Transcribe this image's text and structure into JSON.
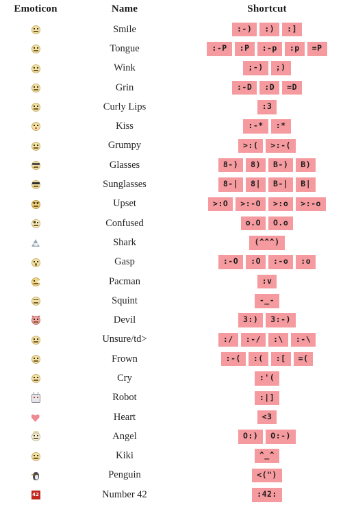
{
  "table": {
    "headers": {
      "emoticon": "Emoticon",
      "name": "Name",
      "shortcut": "Shortcut"
    },
    "badge_color": "#f59a9e",
    "badge_text_color": "#1c1c1c",
    "rows": [
      {
        "icon": "smile-face-icon",
        "variant": "smile",
        "name": "Smile",
        "shortcuts": [
          ":-)",
          ":)",
          ":]"
        ]
      },
      {
        "icon": "tongue-face-icon",
        "variant": "tongue",
        "name": "Tongue",
        "shortcuts": [
          ":-P",
          ":P",
          ":-p",
          ":p",
          "=P"
        ]
      },
      {
        "icon": "wink-face-icon",
        "variant": "wink",
        "name": "Wink",
        "shortcuts": [
          ";-)",
          ";)"
        ]
      },
      {
        "icon": "grin-face-icon",
        "variant": "grin",
        "name": "Grin",
        "shortcuts": [
          ":-D",
          ":D",
          "=D"
        ]
      },
      {
        "icon": "curly-lips-face-icon",
        "variant": "curly",
        "name": "Curly Lips",
        "shortcuts": [
          ":3"
        ]
      },
      {
        "icon": "kiss-face-icon",
        "variant": "kiss",
        "name": "Kiss",
        "shortcuts": [
          ":-*",
          ":*"
        ]
      },
      {
        "icon": "grumpy-face-icon",
        "variant": "grumpy",
        "name": "Grumpy",
        "shortcuts": [
          ">:(",
          ">:-("
        ]
      },
      {
        "icon": "glasses-face-icon",
        "variant": "glasses",
        "name": "Glasses",
        "shortcuts": [
          "8-)",
          "8)",
          "B-)",
          "B)"
        ]
      },
      {
        "icon": "sunglasses-face-icon",
        "variant": "sunglasses",
        "name": "Sunglasses",
        "shortcuts": [
          "8-|",
          "8|",
          "B-|",
          "B|"
        ]
      },
      {
        "icon": "upset-face-icon",
        "variant": "upset",
        "name": "Upset",
        "shortcuts": [
          ">:O",
          ">:-O",
          ">:o",
          ">:-o"
        ]
      },
      {
        "icon": "confused-face-icon",
        "variant": "confused",
        "name": "Confused",
        "shortcuts": [
          "o.O",
          "O.o"
        ]
      },
      {
        "icon": "shark-icon",
        "variant": "shark",
        "name": "Shark",
        "shortcuts": [
          "(^^^)"
        ]
      },
      {
        "icon": "gasp-face-icon",
        "variant": "gasp",
        "name": "Gasp",
        "shortcuts": [
          ":-O",
          ":O",
          ":-o",
          ":o"
        ]
      },
      {
        "icon": "pacman-icon",
        "variant": "pacman",
        "name": "Pacman",
        "shortcuts": [
          ":v"
        ]
      },
      {
        "icon": "squint-face-icon",
        "variant": "squint",
        "name": "Squint",
        "shortcuts": [
          "-_-"
        ]
      },
      {
        "icon": "devil-face-icon",
        "variant": "devil",
        "name": "Devil",
        "shortcuts": [
          "3:)",
          "3:-)"
        ]
      },
      {
        "icon": "unsure-face-icon",
        "variant": "unsure",
        "name": "Unsure/td>",
        "shortcuts": [
          ":/",
          ":-/",
          ":\\",
          ":-\\"
        ]
      },
      {
        "icon": "frown-face-icon",
        "variant": "frown",
        "name": "Frown",
        "shortcuts": [
          ":-(",
          ":(",
          ":[",
          "=("
        ]
      },
      {
        "icon": "cry-face-icon",
        "variant": "cry",
        "name": "Cry",
        "shortcuts": [
          ":'("
        ]
      },
      {
        "icon": "robot-icon",
        "variant": "robot",
        "name": "Robot",
        "shortcuts": [
          ":|]"
        ]
      },
      {
        "icon": "heart-icon",
        "variant": "heart",
        "name": "Heart",
        "shortcuts": [
          "<3"
        ]
      },
      {
        "icon": "angel-face-icon",
        "variant": "angel",
        "name": "Angel",
        "shortcuts": [
          "O:)",
          "O:-)"
        ]
      },
      {
        "icon": "kiki-face-icon",
        "variant": "kiki",
        "name": "Kiki",
        "shortcuts": [
          "^_^"
        ]
      },
      {
        "icon": "penguin-icon",
        "variant": "penguin",
        "name": "Penguin",
        "shortcuts": [
          "<(\")"
        ]
      },
      {
        "icon": "number-42-icon",
        "variant": "num42",
        "name": "Number 42",
        "shortcuts": [
          ":42:"
        ]
      }
    ]
  }
}
